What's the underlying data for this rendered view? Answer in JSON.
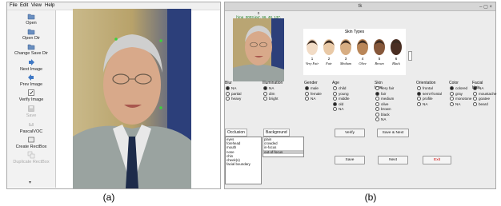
{
  "panel_a": {
    "menu": [
      "File",
      "Edit",
      "View",
      "Help"
    ],
    "tools": [
      {
        "label": "Open",
        "icon": "folder-icon",
        "enabled": true
      },
      {
        "label": "Open Dir",
        "icon": "folder-icon",
        "enabled": true
      },
      {
        "label": "Change Save Dir",
        "icon": "folder-icon",
        "enabled": true
      },
      {
        "label": "Next Image",
        "icon": "arrow-right-icon",
        "enabled": true
      },
      {
        "label": "Prev Image",
        "icon": "arrow-left-icon",
        "enabled": true
      },
      {
        "label": "Verify Image",
        "icon": "checkbox-icon",
        "enabled": true
      },
      {
        "label": "Save",
        "icon": "save-icon",
        "enabled": false
      },
      {
        "label": "PascalVOC",
        "icon": "format-icon",
        "enabled": true
      },
      {
        "label": "Create RectBox",
        "icon": "rectbox-icon",
        "enabled": true
      },
      {
        "label": "Duplicate RectBox",
        "icon": "duplicate-icon",
        "enabled": false
      }
    ],
    "caption": "(a)"
  },
  "panel_b": {
    "window_title": "tk",
    "image_label_index": "0",
    "image_label_file": "['img_0003.jpg', 66, 48, 137, 155]",
    "skin_chart": {
      "title": "Skin Types",
      "types": [
        {
          "num": "1",
          "name": "Very Fair",
          "color": "#f2dcc6"
        },
        {
          "num": "2",
          "name": "Fair",
          "color": "#e9c9a6"
        },
        {
          "num": "3",
          "name": "Medium",
          "color": "#d7ad82"
        },
        {
          "num": "4",
          "name": "Olive",
          "color": "#b98658"
        },
        {
          "num": "5",
          "name": "Brown",
          "color": "#86573a"
        },
        {
          "num": "6",
          "name": "Black",
          "color": "#4a2e22"
        }
      ]
    },
    "groups": [
      {
        "title": "Blur",
        "options": [
          {
            "label": "NA",
            "on": true
          },
          {
            "label": "partial",
            "on": false
          },
          {
            "label": "heavy",
            "on": false
          }
        ]
      },
      {
        "title": "Illumination",
        "options": [
          {
            "label": "NA",
            "on": true
          },
          {
            "label": "dim",
            "on": false
          },
          {
            "label": "bright",
            "on": false
          }
        ]
      },
      {
        "title": "Gender",
        "options": [
          {
            "label": "male",
            "on": true
          },
          {
            "label": "female",
            "on": false
          },
          {
            "label": "NA",
            "on": false
          }
        ]
      },
      {
        "title": "Age",
        "options": [
          {
            "label": "child",
            "on": false
          },
          {
            "label": "young",
            "on": false
          },
          {
            "label": "middle",
            "on": false
          },
          {
            "label": "old",
            "on": true
          },
          {
            "label": "NA",
            "on": false
          }
        ]
      },
      {
        "title": "Skin tone",
        "options": [
          {
            "label": "very fair",
            "on": false
          },
          {
            "label": "fair",
            "on": true
          },
          {
            "label": "medium",
            "on": false
          },
          {
            "label": "olive",
            "on": false
          },
          {
            "label": "brown",
            "on": false
          },
          {
            "label": "black",
            "on": false
          },
          {
            "label": "NA",
            "on": false
          }
        ]
      },
      {
        "title": "Orientation",
        "options": [
          {
            "label": "frontal",
            "on": false
          },
          {
            "label": "semi-frontal",
            "on": true
          },
          {
            "label": "profile",
            "on": false
          },
          {
            "label": "NA",
            "on": false
          }
        ]
      },
      {
        "title": "Color",
        "options": [
          {
            "label": "colored",
            "on": true
          },
          {
            "label": "gray",
            "on": false
          },
          {
            "label": "monotone",
            "on": false
          },
          {
            "label": "NA",
            "on": false
          }
        ]
      },
      {
        "title": "Facial Hair",
        "options": [
          {
            "label": "NA",
            "on": true
          },
          {
            "label": "moustache",
            "on": false
          },
          {
            "label": "goatee",
            "on": false
          },
          {
            "label": "beard",
            "on": false
          }
        ]
      }
    ],
    "occlusion": {
      "title": "Occlusion",
      "items": [
        "eyes",
        "forehead",
        "mouth",
        "nose",
        "chin",
        "cheek(s)",
        "facial boundary"
      ]
    },
    "background": {
      "title": "Background",
      "items": [
        "plain",
        "crowded",
        "in-focus",
        "out-of-focus"
      ],
      "selected": 3
    },
    "buttons": {
      "verify": "Verify",
      "save_next": "Save & Next",
      "save": "Save",
      "next": "Next",
      "exit": "Exit"
    },
    "caption": "(b)"
  }
}
